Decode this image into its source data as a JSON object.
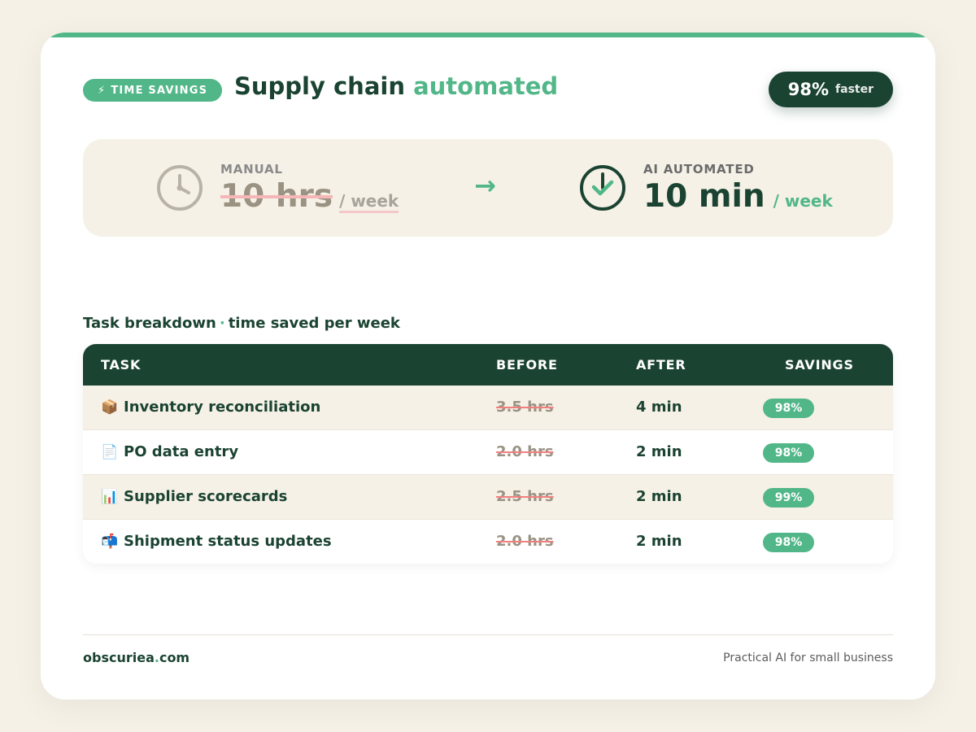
{
  "header": {
    "badge_icon": "⚡",
    "badge_label": "TIME SAVINGS",
    "title_main": "Supply chain",
    "title_accent": "automated",
    "faster_pct": "98%",
    "faster_label": "faster"
  },
  "comparison": {
    "manual_label": "MANUAL",
    "manual_value": "10 hrs",
    "manual_unit": "/ week",
    "arrow": "→",
    "ai_label": "AI AUTOMATED",
    "ai_value": "10 min",
    "ai_unit": "/ week",
    "manual_icon": "clock-icon",
    "ai_icon": "clock-check-icon"
  },
  "breakdown": {
    "title_main": "Task breakdown",
    "separator": "·",
    "title_sub": "time saved per week"
  },
  "table": {
    "headers": {
      "task": "TASK",
      "before": "BEFORE",
      "after": "AFTER",
      "savings": "SAVINGS"
    },
    "rows": [
      {
        "emoji": "📦",
        "task": "Inventory reconciliation",
        "before": "3.5 hrs",
        "after": "4 min",
        "savings": "98%"
      },
      {
        "emoji": "📄",
        "task": "PO data entry",
        "before": "2.0 hrs",
        "after": "2 min",
        "savings": "98%"
      },
      {
        "emoji": "📊",
        "task": "Supplier scorecards",
        "before": "2.5 hrs",
        "after": "2 min",
        "savings": "99%"
      },
      {
        "emoji": "📬",
        "task": "Shipment status updates",
        "before": "2.0 hrs",
        "after": "2 min",
        "savings": "98%"
      }
    ]
  },
  "footer": {
    "brand_main": "obscuriea",
    "brand_dot": ".",
    "brand_tld": "com",
    "tagline": "Practical AI for small business"
  },
  "colors": {
    "accent": "#52b788",
    "dark": "#1b4332",
    "cream": "#f6f1e7"
  }
}
